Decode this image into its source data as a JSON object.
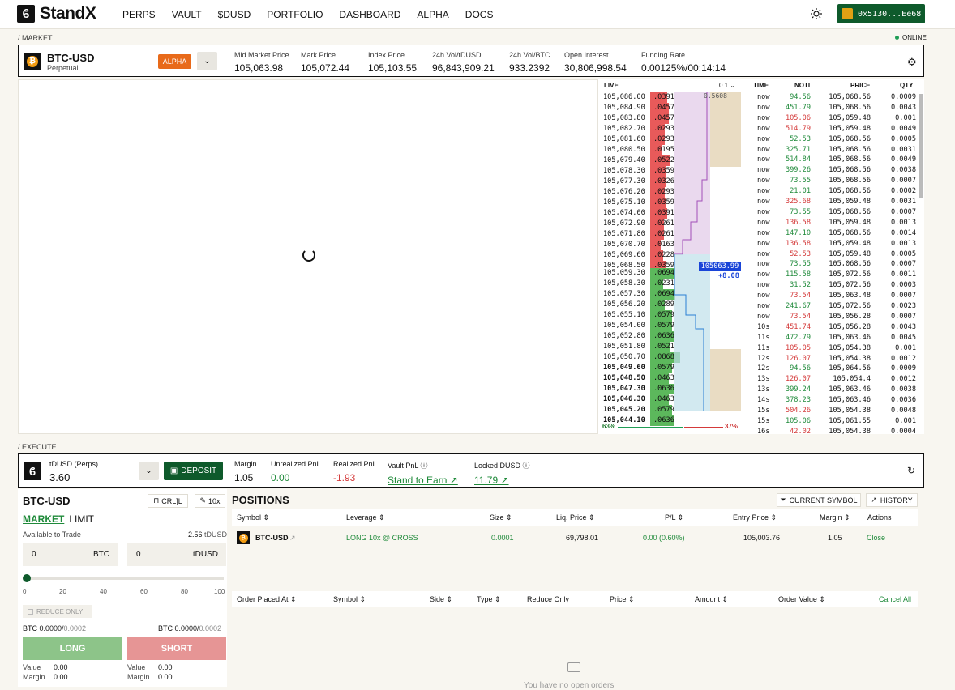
{
  "brand": {
    "name": "StandX",
    "mark": "ϐ"
  },
  "nav": [
    "PERPS",
    "VAULT",
    "$DUSD",
    "PORTFOLIO",
    "DASHBOARD",
    "ALPHA",
    "DOCS"
  ],
  "wallet": {
    "address": "0x5130...Ee68"
  },
  "sections": {
    "market": "/ MARKET",
    "execute": "/ EXECUTE",
    "online": "ONLINE"
  },
  "market": {
    "symbol": "BTC-USD",
    "type": "Perpetual",
    "badge": "ALPHA",
    "stats": [
      {
        "label": "Mid Market Price",
        "value": "105,063.98"
      },
      {
        "label": "Mark Price",
        "value": "105,072.44"
      },
      {
        "label": "Index Price",
        "value": "105,103.55"
      },
      {
        "label": "24h Vol/tDUSD",
        "value": "96,843,909.21"
      },
      {
        "label": "24h Vol/BTC",
        "value": "933.2392"
      },
      {
        "label": "Open Interest",
        "value": "30,806,998.54"
      },
      {
        "label": "Funding Rate",
        "value": "0.00125%/00:14:14"
      }
    ]
  },
  "orderbook": {
    "live": "LIVE",
    "tick": "0.1 ⌄",
    "snippet": "0.5608",
    "asks": [
      [
        "105,086.00",
        ".0391"
      ],
      [
        "105,084.90",
        ".0457"
      ],
      [
        "105,083.80",
        ".0457"
      ],
      [
        "105,082.70",
        ".0293"
      ],
      [
        "105,081.60",
        ".0293"
      ],
      [
        "105,080.50",
        ".0195"
      ],
      [
        "105,079.40",
        ".0522"
      ],
      [
        "105,078.30",
        ".0359"
      ],
      [
        "105,077.30",
        ".0326"
      ],
      [
        "105,076.20",
        ".0293"
      ],
      [
        "105,075.10",
        ".0359"
      ],
      [
        "105,074.00",
        ".0391"
      ],
      [
        "105,072.90",
        ".0261"
      ],
      [
        "105,071.80",
        ".0261"
      ],
      [
        "105,070.70",
        ".0163"
      ],
      [
        "105,069.60",
        ".0228"
      ],
      [
        "105,068.50",
        ".0359"
      ]
    ],
    "bids": [
      [
        "105,059.30",
        ".0694"
      ],
      [
        "105,058.30",
        ".0231"
      ],
      [
        "105,057.30",
        ".0694"
      ],
      [
        "105,056.20",
        ".0289"
      ],
      [
        "105,055.10",
        ".0579"
      ],
      [
        "105,054.00",
        ".0579"
      ],
      [
        "105,052.80",
        ".0636"
      ],
      [
        "105,051.80",
        ".0521"
      ],
      [
        "105,050.70",
        ".0868"
      ],
      [
        "105,049.60",
        ".0579"
      ],
      [
        "105,048.50",
        ".0463"
      ],
      [
        "105,047.30",
        ".0636"
      ],
      [
        "105,046.30",
        ".0463"
      ],
      [
        "105,045.20",
        ".0579"
      ],
      [
        "105,044.10",
        ".0636"
      ]
    ],
    "mid": "105063.99",
    "mid_change": "+8.08",
    "bid_pct": "63%",
    "ask_pct": "37%"
  },
  "trades": {
    "headers": [
      "TIME",
      "NOTL",
      "PRICE",
      "QTY"
    ],
    "rows": [
      [
        "now",
        "94.56",
        "105,068.56",
        "0.0009",
        "g"
      ],
      [
        "now",
        "451.79",
        "105,068.56",
        "0.0043",
        "g"
      ],
      [
        "now",
        "105.06",
        "105,059.48",
        "0.001",
        "r"
      ],
      [
        "now",
        "514.79",
        "105,059.48",
        "0.0049",
        "r"
      ],
      [
        "now",
        "52.53",
        "105,068.56",
        "0.0005",
        "g"
      ],
      [
        "now",
        "325.71",
        "105,068.56",
        "0.0031",
        "g"
      ],
      [
        "now",
        "514.84",
        "105,068.56",
        "0.0049",
        "g"
      ],
      [
        "now",
        "399.26",
        "105,068.56",
        "0.0038",
        "g"
      ],
      [
        "now",
        "73.55",
        "105,068.56",
        "0.0007",
        "g"
      ],
      [
        "now",
        "21.01",
        "105,068.56",
        "0.0002",
        "g"
      ],
      [
        "now",
        "325.68",
        "105,059.48",
        "0.0031",
        "r"
      ],
      [
        "now",
        "73.55",
        "105,068.56",
        "0.0007",
        "g"
      ],
      [
        "now",
        "136.58",
        "105,059.48",
        "0.0013",
        "r"
      ],
      [
        "now",
        "147.10",
        "105,068.56",
        "0.0014",
        "g"
      ],
      [
        "now",
        "136.58",
        "105,059.48",
        "0.0013",
        "r"
      ],
      [
        "now",
        "52.53",
        "105,059.48",
        "0.0005",
        "r"
      ],
      [
        "now",
        "73.55",
        "105,068.56",
        "0.0007",
        "g"
      ],
      [
        "now",
        "115.58",
        "105,072.56",
        "0.0011",
        "g"
      ],
      [
        "now",
        "31.52",
        "105,072.56",
        "0.0003",
        "g"
      ],
      [
        "now",
        "73.54",
        "105,063.48",
        "0.0007",
        "r"
      ],
      [
        "now",
        "241.67",
        "105,072.56",
        "0.0023",
        "g"
      ],
      [
        "now",
        "73.54",
        "105,056.28",
        "0.0007",
        "r"
      ],
      [
        "10s",
        "451.74",
        "105,056.28",
        "0.0043",
        "r"
      ],
      [
        "11s",
        "472.79",
        "105,063.46",
        "0.0045",
        "g"
      ],
      [
        "11s",
        "105.05",
        "105,054.38",
        "0.001",
        "r"
      ],
      [
        "12s",
        "126.07",
        "105,054.38",
        "0.0012",
        "r"
      ],
      [
        "12s",
        "94.56",
        "105,064.56",
        "0.0009",
        "g"
      ],
      [
        "13s",
        "126.07",
        "105,054.4",
        "0.0012",
        "r"
      ],
      [
        "13s",
        "399.24",
        "105,063.46",
        "0.0038",
        "g"
      ],
      [
        "14s",
        "378.23",
        "105,063.46",
        "0.0036",
        "g"
      ],
      [
        "15s",
        "504.26",
        "105,054.38",
        "0.0048",
        "r"
      ],
      [
        "15s",
        "105.06",
        "105,061.55",
        "0.001",
        "g"
      ],
      [
        "16s",
        "42.02",
        "105,054.38",
        "0.0004",
        "r"
      ]
    ]
  },
  "execute": {
    "account_label": "tDUSD (Perps)",
    "account_value": "3.60",
    "deposit": "DEPOSIT",
    "stats": [
      {
        "label": "Margin",
        "value": "1.05",
        "cls": ""
      },
      {
        "label": "Unrealized PnL",
        "value": "0.00",
        "cls": "green"
      },
      {
        "label": "Realized PnL",
        "value": "-1.93",
        "cls": "red"
      },
      {
        "label": "Vault PnL ⓘ",
        "value": "Stand to Earn ↗",
        "cls": "link"
      },
      {
        "label": "Locked DUSD ⓘ",
        "value": "11.79 ↗",
        "cls": "link"
      }
    ]
  },
  "order": {
    "symbol": "BTC-USD",
    "margin_mode": "CRL]L",
    "leverage": "10x",
    "tab_market": "MARKET",
    "tab_limit": "LIMIT",
    "available_label": "Available to Trade",
    "available_value": "2.56",
    "available_unit": "tDUSD",
    "input1": {
      "value": "0",
      "unit": "BTC"
    },
    "input2": {
      "value": "0",
      "unit": "tDUSD"
    },
    "slider_ticks": [
      "0",
      "20",
      "40",
      "60",
      "80",
      "100"
    ],
    "slider_percent": 0,
    "reduce_only": "REDUCE ONLY",
    "bal_left": "BTC 0.0000/",
    "bal_left_max": "0.0002",
    "bal_right": "BTC 0.0000/",
    "bal_right_max": "0.0002",
    "long": "LONG",
    "short": "SHORT",
    "value_label": "Value",
    "margin_label": "Margin",
    "long_value": "0.00",
    "long_margin": "0.00",
    "short_value": "0.00",
    "short_margin": "0.00"
  },
  "positions": {
    "title": "POSITIONS",
    "current_symbol": "CURRENT SYMBOL",
    "history": "HISTORY",
    "headers": [
      "Symbol  ⇕",
      "Leverage  ⇕",
      "Size  ⇕",
      "Liq. Price  ⇕",
      "P/L  ⇕",
      "Entry Price  ⇕",
      "Margin  ⇕",
      "Actions"
    ],
    "row": {
      "symbol": "BTC-USD",
      "leverage": "LONG 10x @ CROSS",
      "size": "0.0001",
      "liq": "69,798.01",
      "pl": "0.00 (0.60%)",
      "entry": "105,003.76",
      "margin": "1.05",
      "action": "Close"
    },
    "order_headers": [
      "Order Placed At  ⇕",
      "Symbol  ⇕",
      "Side  ⇕",
      "Type  ⇕",
      "Reduce Only",
      "Price  ⇕",
      "Amount  ⇕",
      "Order Value  ⇕"
    ],
    "cancel_all": "Cancel All",
    "empty": "You have no open orders"
  }
}
